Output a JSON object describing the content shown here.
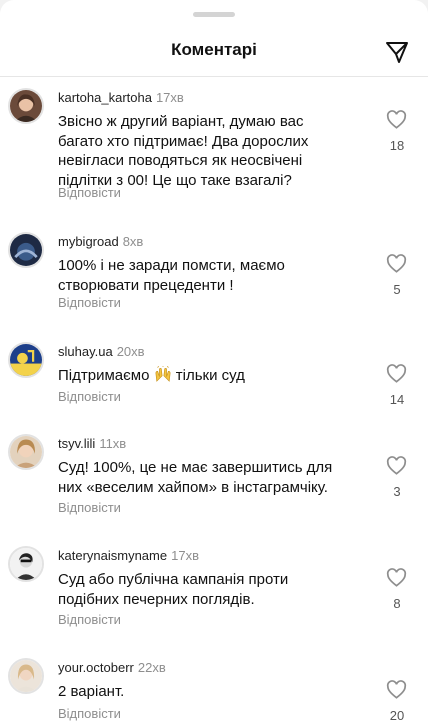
{
  "header": {
    "title": "Коментарі",
    "send_icon": "paper-plane-icon"
  },
  "comments": [
    {
      "username": "kartoha_kartoha",
      "time": "17хв",
      "text": "Звісно ж другий варіант, думаю вас багато хто підтримає! Два дорослих невігласи поводяться як неосвічені підлітки з 00! Це що таке взагалі?",
      "reply": "Відповісти",
      "likes": "18"
    },
    {
      "username": "mybigroad",
      "time": "8хв",
      "text": "100% і не заради помсти, маємо створювати прецеденти !",
      "reply": "Відповісти",
      "likes": "5"
    },
    {
      "username": "sluhay.ua",
      "time": "20хв",
      "text_before": "Підтримаємо",
      "text_after": "тільки суд",
      "emoji": "raising-hands-emoji",
      "reply": "Відповісти",
      "likes": "14"
    },
    {
      "username": "tsyv.lili",
      "time": "11хв",
      "text": "Суд! 100%, це не має завершитись для них «веселим хайпом» в інстаграмчіку.",
      "reply": "Відповісти",
      "likes": "3"
    },
    {
      "username": "katerynaismyname",
      "time": "17хв",
      "text": "Суд або публічна кампанія проти подібних печерних поглядів.",
      "reply": "Відповісти",
      "likes": "8"
    },
    {
      "username": "your.octoberr",
      "time": "22хв",
      "text": "2 варіант.",
      "reply": "Відповісти",
      "likes": "20"
    }
  ],
  "colors": {
    "muted": "#8e8e8e",
    "background": "#ffffff",
    "divider": "#e6e6e6"
  }
}
